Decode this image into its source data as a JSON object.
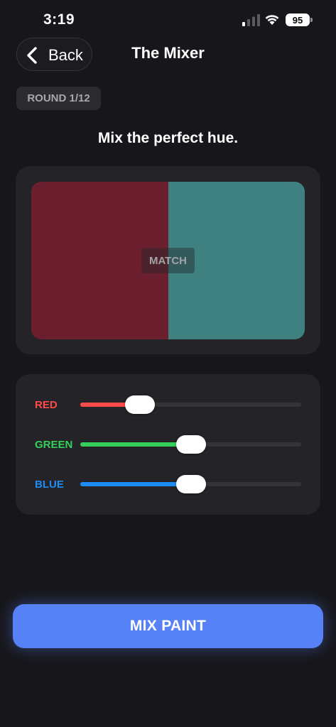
{
  "status_bar": {
    "time": "3:19",
    "battery": "95"
  },
  "header": {
    "back_label": "Back",
    "title": "The Mixer"
  },
  "round_badge": "ROUND 1/12",
  "instruction": "Mix the perfect hue.",
  "swatch": {
    "match_label": "MATCH",
    "target_color": "#6b1f2e",
    "current_color": "#3e8180"
  },
  "sliders": [
    {
      "label": "RED",
      "color": "#ff4a4a",
      "level": 0.27
    },
    {
      "label": "GREEN",
      "color": "#34d05a",
      "level": 0.5
    },
    {
      "label": "BLUE",
      "color": "#1e8cf5",
      "level": 0.5
    }
  ],
  "mix_button": {
    "label": "MIX PAINT",
    "color": "#5781f7"
  }
}
